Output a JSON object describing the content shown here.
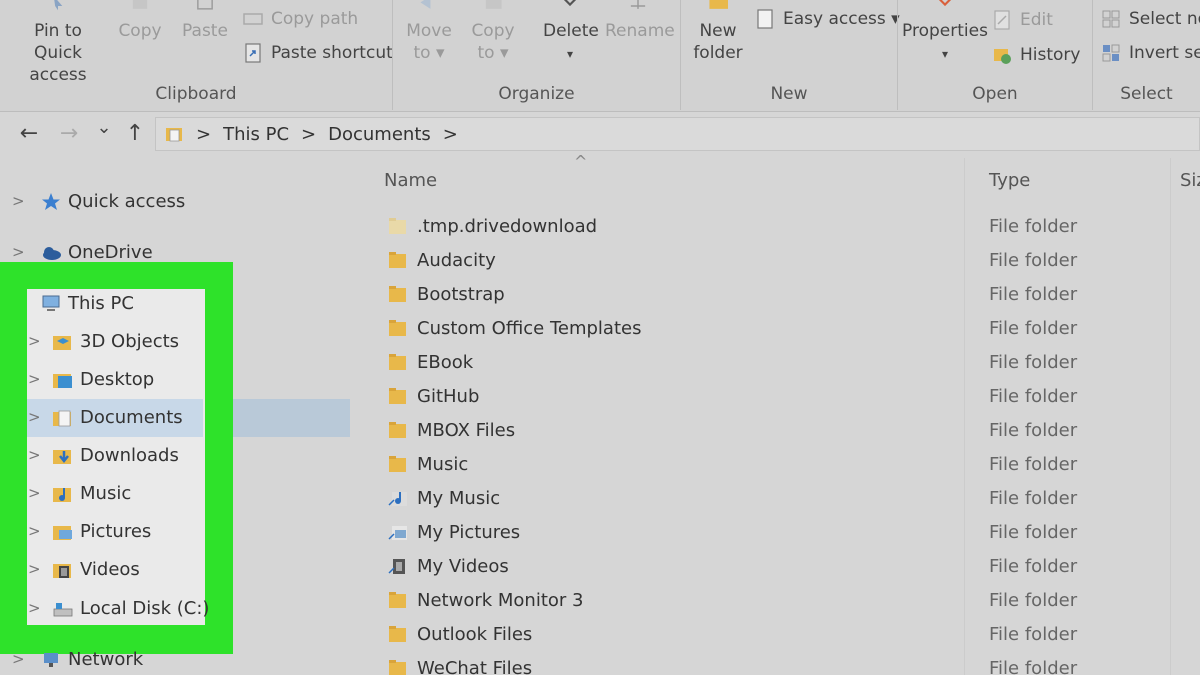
{
  "ribbon": {
    "clipboard": {
      "label": "Clipboard",
      "pin_label_1": "Pin to Quick",
      "pin_label_2": "access",
      "copy_label": "Copy",
      "paste_label": "Paste",
      "copy_path_label": "Copy path",
      "paste_shortcut_label": "Paste shortcut"
    },
    "organize": {
      "label": "Organize",
      "move_to_1": "Move",
      "move_to_2": "to ▾",
      "copy_to_1": "Copy",
      "copy_to_2": "to ▾",
      "delete_label": "Delete",
      "delete_arrow": "▾",
      "rename_label": "Rename"
    },
    "new": {
      "label": "New",
      "new_folder_1": "New",
      "new_folder_2": "folder",
      "easy_access_label": "Easy access ▾"
    },
    "open": {
      "label": "Open",
      "properties_label": "Properties",
      "properties_arrow": "▾",
      "edit_label": "Edit",
      "history_label": "History"
    },
    "select": {
      "label": "Select",
      "select_none_label": "Select no",
      "invert_selection_label": "Invert sele"
    }
  },
  "address": {
    "back": "←",
    "forward": "→",
    "recent": "⌄",
    "up": "↑",
    "crumbs": [
      "This PC",
      "Documents"
    ],
    "sep": ">"
  },
  "nav": {
    "quick_access": "Quick access",
    "onedrive": "OneDrive",
    "this_pc": "This PC",
    "items": [
      "3D Objects",
      "Desktop",
      "Documents",
      "Downloads",
      "Music",
      "Pictures",
      "Videos",
      "Local Disk (C:)"
    ],
    "network": "Network",
    "chevron": ">"
  },
  "columns": {
    "name": "Name",
    "type": "Type",
    "size": "Siz",
    "sort_arrow": "^"
  },
  "files": [
    {
      "name": ".tmp.drivedownload",
      "type": "File folder",
      "icon": "folder-faded-icon"
    },
    {
      "name": "Audacity",
      "type": "File folder",
      "icon": "folder-icon"
    },
    {
      "name": "Bootstrap",
      "type": "File folder",
      "icon": "folder-icon"
    },
    {
      "name": "Custom Office Templates",
      "type": "File folder",
      "icon": "folder-icon"
    },
    {
      "name": "EBook",
      "type": "File folder",
      "icon": "folder-icon"
    },
    {
      "name": "GitHub",
      "type": "File folder",
      "icon": "folder-icon"
    },
    {
      "name": "MBOX Files",
      "type": "File folder",
      "icon": "folder-icon"
    },
    {
      "name": "Music",
      "type": "File folder",
      "icon": "folder-icon"
    },
    {
      "name": "My Music",
      "type": "File folder",
      "icon": "music-shortcut-icon"
    },
    {
      "name": "My Pictures",
      "type": "File folder",
      "icon": "pictures-shortcut-icon"
    },
    {
      "name": "My Videos",
      "type": "File folder",
      "icon": "videos-shortcut-icon"
    },
    {
      "name": "Network Monitor 3",
      "type": "File folder",
      "icon": "folder-icon"
    },
    {
      "name": "Outlook Files",
      "type": "File folder",
      "icon": "folder-icon"
    },
    {
      "name": "WeChat Files",
      "type": "File folder",
      "icon": "folder-icon"
    }
  ],
  "colors": {
    "highlight_green": "#2ee22a",
    "selection": "#b9c9d8",
    "folder": "#e8b84a"
  }
}
